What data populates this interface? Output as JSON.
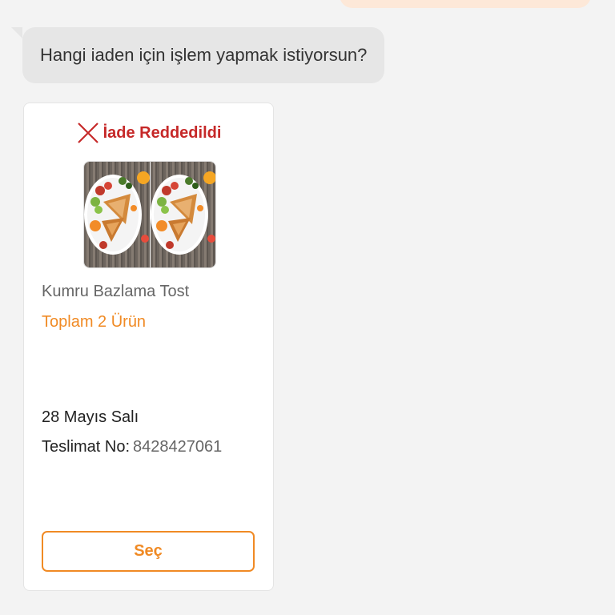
{
  "chat": {
    "bot_message": "Hangi iaden için işlem yapmak istiyorsun?"
  },
  "return_card": {
    "status_icon": "close-icon",
    "status_label": "İade Reddedildi",
    "status_color": "#c62828",
    "product_name": "Kumru Bazlama Tost",
    "total_label": "Toplam 2 Ürün",
    "date": "28 Mayıs Salı",
    "delivery_label": "Teslimat No",
    "delivery_separator": ":",
    "delivery_number": "8428427061",
    "select_button_label": "Seç",
    "accent_color": "#f08a24"
  }
}
